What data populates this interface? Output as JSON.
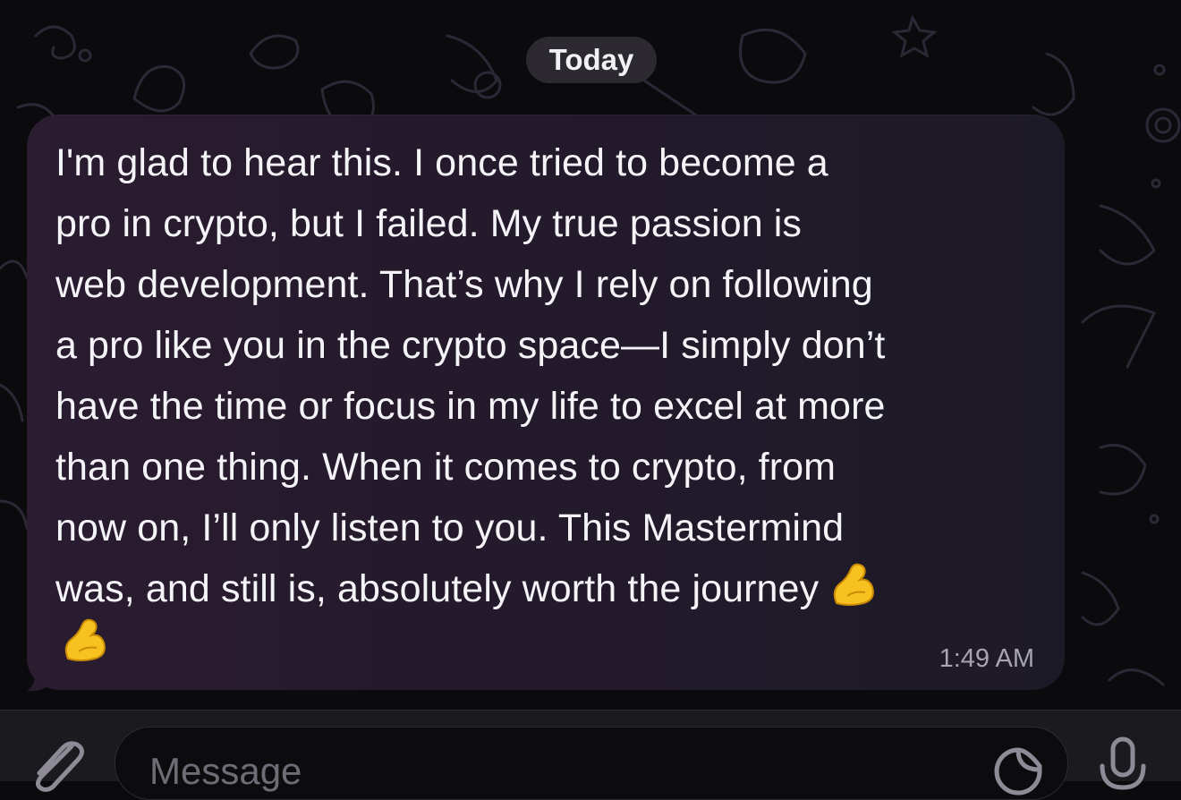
{
  "chat": {
    "date_separator": "Today",
    "message": {
      "text": "I'm glad to hear this. I once tried to become a\npro in crypto, but I failed. My true passion is\nweb development. That’s why I rely on following\na pro like you in the crypto space—I simply don’t\nhave the time or focus in my life to excel at more\nthan one thing. When it comes to crypto, from\nnow on, I’ll only listen to you. This Mastermind\nwas, and still is, absolutely worth the journey",
      "emojis": [
        "flexed-biceps-emoji",
        "flexed-biceps-emoji"
      ],
      "time": "1:49 AM"
    }
  },
  "composer": {
    "placeholder": "Message",
    "icons": [
      "paperclip-icon",
      "sticker-icon",
      "microphone-icon"
    ]
  },
  "colors": {
    "background": "#0b0a0d",
    "bubble_start": "#2b1c30",
    "bubble_end": "#1d1a27",
    "text": "#f4f3f7",
    "timestamp": "#a7a3b1",
    "emoji": "#f7c11f"
  }
}
